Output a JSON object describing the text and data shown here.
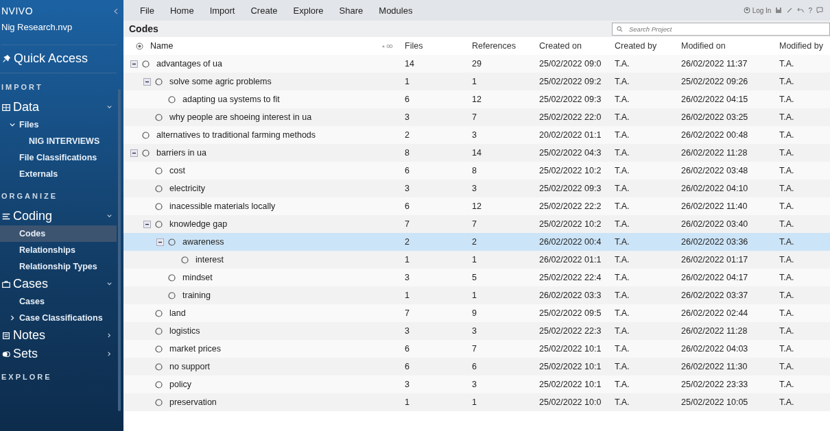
{
  "sidebar": {
    "logo": "NVIVO",
    "project": "Nig Research.nvp",
    "items": [
      {
        "kind": "link",
        "label": "Quick Access"
      },
      {
        "kind": "section",
        "label": "IMPORT"
      },
      {
        "kind": "group",
        "label": "Data",
        "expanded": true
      },
      {
        "kind": "item",
        "label": "Files",
        "selected": false,
        "expanded": true,
        "children": [
          {
            "label": "NIG INTERVIEWS",
            "selected": false
          }
        ]
      },
      {
        "kind": "item",
        "label": "File Classifications",
        "selected": false
      },
      {
        "kind": "item",
        "label": "Externals",
        "selected": false
      },
      {
        "kind": "section",
        "label": "ORGANIZE"
      },
      {
        "kind": "group",
        "label": "Coding",
        "expanded": true
      },
      {
        "kind": "item",
        "label": "Codes",
        "selected": true
      },
      {
        "kind": "item",
        "label": "Relationships",
        "selected": false
      },
      {
        "kind": "item",
        "label": "Relationship Types",
        "selected": false
      },
      {
        "kind": "group",
        "label": "Cases",
        "expanded": true
      },
      {
        "kind": "item",
        "label": "Cases",
        "selected": false
      },
      {
        "kind": "item",
        "label": "Case Classifications",
        "selected": false,
        "expanded": false
      },
      {
        "kind": "group",
        "label": "Notes",
        "expanded": false
      },
      {
        "kind": "group",
        "label": "Sets",
        "expanded": false
      },
      {
        "kind": "section",
        "label": "EXPLORE"
      }
    ]
  },
  "menu": [
    "File",
    "Home",
    "Import",
    "Create",
    "Explore",
    "Share",
    "Modules"
  ],
  "toolbar": {
    "login": "Log In",
    "help": "?"
  },
  "panel": {
    "title": "Codes",
    "search": {
      "placeholder": "Search Project"
    }
  },
  "table": {
    "columns": [
      "Name",
      "Files",
      "References",
      "Created on",
      "Created by",
      "Modified on",
      "Modified by"
    ],
    "rows": [
      {
        "name": "advantages of ua",
        "files": "14",
        "references": "29",
        "created_on": "25/02/2022 09:0",
        "created_by": "T.A.",
        "modified_on": "26/02/2022 11:37",
        "modified_by": "T.A.",
        "selected": false,
        "expanded": true,
        "children": [
          {
            "name": "solve some agric problems",
            "files": "1",
            "references": "1",
            "created_on": "25/02/2022 09:2",
            "created_by": "T.A.",
            "modified_on": "25/02/2022 09:26",
            "modified_by": "T.A.",
            "selected": false,
            "expanded": true,
            "children": [
              {
                "name": "adapting ua systems to fit",
                "files": "6",
                "references": "12",
                "created_on": "25/02/2022 09:3",
                "created_by": "T.A.",
                "modified_on": "26/02/2022 04:15",
                "modified_by": "T.A.",
                "selected": false
              }
            ]
          },
          {
            "name": "why people are shoeing interest in ua",
            "files": "3",
            "references": "7",
            "created_on": "25/02/2022 22:0",
            "created_by": "T.A.",
            "modified_on": "26/02/2022 03:25",
            "modified_by": "T.A.",
            "selected": false
          }
        ]
      },
      {
        "name": "alternatives to traditional farming methods",
        "files": "2",
        "references": "3",
        "created_on": "20/02/2022 01:1",
        "created_by": "T.A.",
        "modified_on": "26/02/2022 00:48",
        "modified_by": "T.A.",
        "selected": false
      },
      {
        "name": "barriers in ua",
        "files": "8",
        "references": "14",
        "created_on": "25/02/2022 04:3",
        "created_by": "T.A.",
        "modified_on": "26/02/2022 11:28",
        "modified_by": "T.A.",
        "selected": false,
        "expanded": true,
        "children": [
          {
            "name": "cost",
            "files": "6",
            "references": "8",
            "created_on": "25/02/2022 10:2",
            "created_by": "T.A.",
            "modified_on": "26/02/2022 03:48",
            "modified_by": "T.A.",
            "selected": false
          },
          {
            "name": "electricity",
            "files": "3",
            "references": "3",
            "created_on": "25/02/2022 09:3",
            "created_by": "T.A.",
            "modified_on": "26/02/2022 04:10",
            "modified_by": "T.A.",
            "selected": false
          },
          {
            "name": "inacessible materials locally",
            "files": "6",
            "references": "12",
            "created_on": "25/02/2022 22:2",
            "created_by": "T.A.",
            "modified_on": "26/02/2022 11:40",
            "modified_by": "T.A.",
            "selected": false
          },
          {
            "name": "knowledge gap",
            "files": "7",
            "references": "7",
            "created_on": "25/02/2022 10:2",
            "created_by": "T.A.",
            "modified_on": "26/02/2022 03:40",
            "modified_by": "T.A.",
            "selected": false,
            "expanded": true,
            "children": [
              {
                "name": "awareness",
                "files": "2",
                "references": "2",
                "created_on": "26/02/2022 00:4",
                "created_by": "T.A.",
                "modified_on": "26/02/2022 03:36",
                "modified_by": "T.A.",
                "selected": true,
                "expanded": true,
                "children": [
                  {
                    "name": "interest",
                    "files": "1",
                    "references": "1",
                    "created_on": "26/02/2022 01:1",
                    "created_by": "T.A.",
                    "modified_on": "26/02/2022 01:17",
                    "modified_by": "T.A.",
                    "selected": false
                  }
                ]
              },
              {
                "name": "mindset",
                "files": "3",
                "references": "5",
                "created_on": "25/02/2022 22:4",
                "created_by": "T.A.",
                "modified_on": "26/02/2022 04:17",
                "modified_by": "T.A.",
                "selected": false
              },
              {
                "name": "training",
                "files": "1",
                "references": "1",
                "created_on": "26/02/2022 03:3",
                "created_by": "T.A.",
                "modified_on": "26/02/2022 03:37",
                "modified_by": "T.A.",
                "selected": false
              }
            ]
          },
          {
            "name": "land",
            "files": "7",
            "references": "9",
            "created_on": "25/02/2022 09:5",
            "created_by": "T.A.",
            "modified_on": "26/02/2022 02:44",
            "modified_by": "T.A.",
            "selected": false
          },
          {
            "name": "logistics",
            "files": "3",
            "references": "3",
            "created_on": "25/02/2022 22:3",
            "created_by": "T.A.",
            "modified_on": "26/02/2022 11:28",
            "modified_by": "T.A.",
            "selected": false
          },
          {
            "name": "market prices",
            "files": "6",
            "references": "7",
            "created_on": "25/02/2022 10:1",
            "created_by": "T.A.",
            "modified_on": "26/02/2022 04:03",
            "modified_by": "T.A.",
            "selected": false
          },
          {
            "name": "no support",
            "files": "6",
            "references": "6",
            "created_on": "25/02/2022 10:1",
            "created_by": "T.A.",
            "modified_on": "26/02/2022 11:30",
            "modified_by": "T.A.",
            "selected": false
          },
          {
            "name": "policy",
            "files": "3",
            "references": "3",
            "created_on": "25/02/2022 10:1",
            "created_by": "T.A.",
            "modified_on": "25/02/2022 23:33",
            "modified_by": "T.A.",
            "selected": false
          },
          {
            "name": "preservation",
            "files": "1",
            "references": "1",
            "created_on": "25/02/2022 10:0",
            "created_by": "T.A.",
            "modified_on": "25/02/2022 10:05",
            "modified_by": "T.A.",
            "selected": false
          }
        ]
      }
    ]
  }
}
